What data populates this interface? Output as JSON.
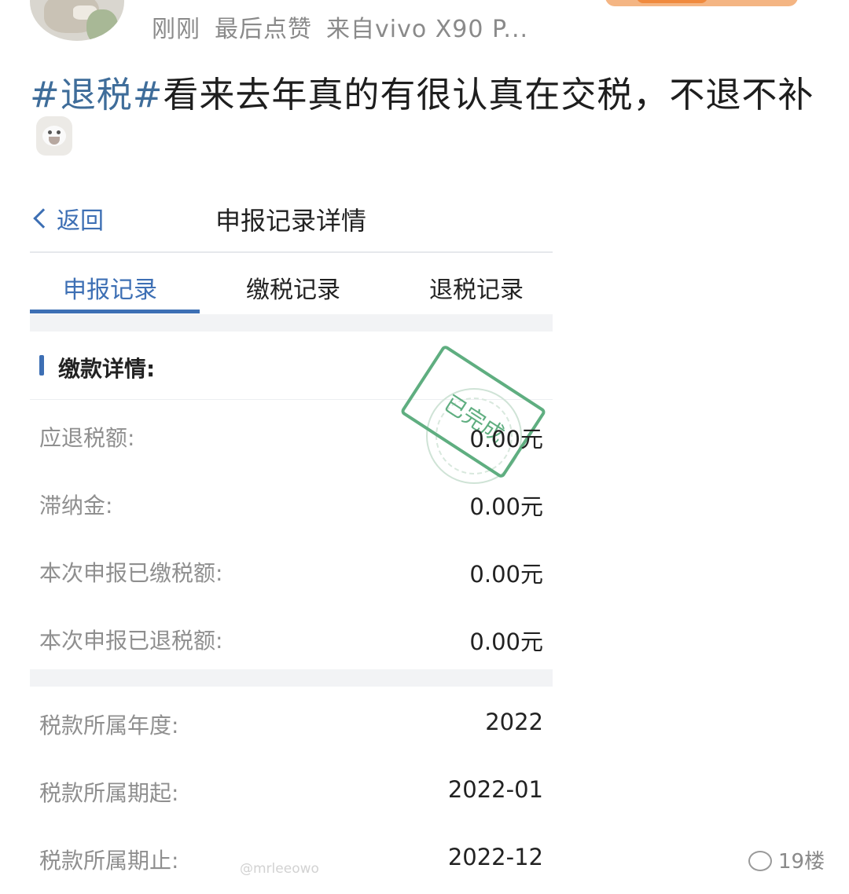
{
  "post": {
    "meta_time": "刚刚",
    "meta_like": "最后点赞",
    "meta_device": "来自vivo X90 P...",
    "hashtag": "#退税#",
    "text": "看来去年真的有很认真在交税，不退不补"
  },
  "screen": {
    "back_label": "返回",
    "title": "申报记录详情",
    "tabs": [
      "申报记录",
      "缴税记录",
      "退税记录"
    ],
    "active_tab": 0,
    "section_title": "缴款详情:",
    "stamp_text": "已完成",
    "details": [
      {
        "label": "应退税额:",
        "value": "0.00元"
      },
      {
        "label": "滞纳金:",
        "value": "0.00元"
      },
      {
        "label": "本次申报已缴税额:",
        "value": "0.00元"
      },
      {
        "label": "本次申报已退税额:",
        "value": "0.00元"
      }
    ],
    "period": [
      {
        "label": "税款所属年度:",
        "value": "2022"
      },
      {
        "label": "税款所属期起:",
        "value": "2022-01"
      },
      {
        "label": "税款所属期止:",
        "value": "2022-12"
      }
    ]
  },
  "watermark": "@mrleeowo",
  "brand": "19楼",
  "colors": {
    "accent": "#3d6fb4",
    "hashtag": "#3f6d9a",
    "stamp": "#5fae80"
  }
}
